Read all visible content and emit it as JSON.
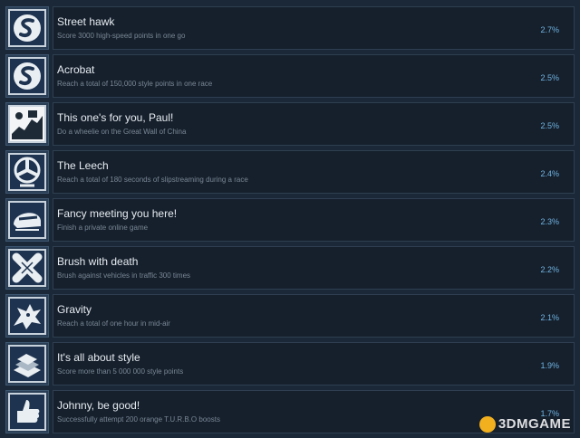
{
  "achievements": [
    {
      "title": "Street hawk",
      "desc": "Score 3000 high-speed points in one go",
      "pct": "2.7%",
      "icon": "s-logo-icon"
    },
    {
      "title": "Acrobat",
      "desc": "Reach a total of 150,000 style points in one race",
      "pct": "2.5%",
      "icon": "s-logo-icon"
    },
    {
      "title": "This one's for you, Paul!",
      "desc": "Do a wheelie on the Great Wall of China",
      "pct": "2.5%",
      "icon": "wall-icon"
    },
    {
      "title": "The Leech",
      "desc": "Reach a total of 180 seconds of slipstreaming during a race",
      "pct": "2.4%",
      "icon": "fan-icon"
    },
    {
      "title": "Fancy meeting you here!",
      "desc": "Finish a private online game",
      "pct": "2.3%",
      "icon": "helmet-icon"
    },
    {
      "title": "Brush with death",
      "desc": "Brush against vehicles in traffic 300 times",
      "pct": "2.2%",
      "icon": "crossed-bandage-icon"
    },
    {
      "title": "Gravity",
      "desc": "Reach a total of one hour in mid-air",
      "pct": "2.1%",
      "icon": "dragon-icon"
    },
    {
      "title": "It's all about style",
      "desc": "Score more than 5 000 000 style points",
      "pct": "1.9%",
      "icon": "stack-icon"
    },
    {
      "title": "Johnny, be good!",
      "desc": "Successfully attempt 200 orange T.U.R.B.O boosts",
      "pct": "1.7%",
      "icon": "thumbs-up-icon"
    }
  ],
  "watermark": "3DMGAME",
  "colors": {
    "background": "#1b2838",
    "row": "#16202d",
    "percent": "#6fb3e0",
    "icon_bg": "#2a3f55"
  }
}
